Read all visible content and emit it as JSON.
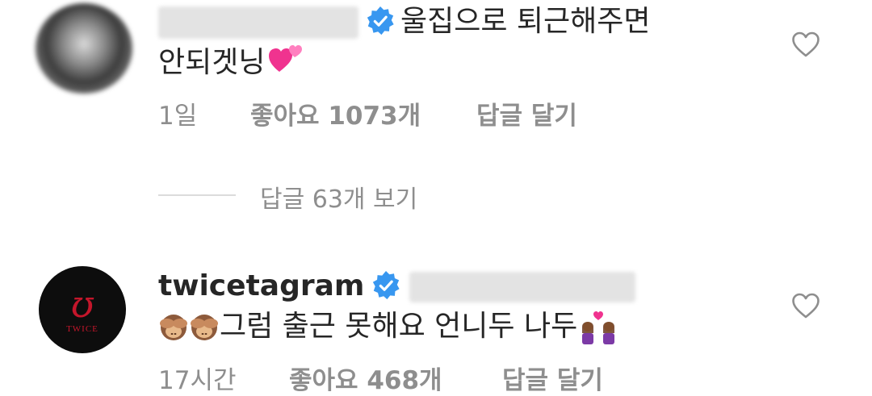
{
  "comments": [
    {
      "text_line1": "울집으로 퇴근해주면",
      "text_line2": "안되겟닝",
      "time": "1일",
      "likes": "좋아요 1073개",
      "reply": "답글 달기"
    },
    {
      "username": "twicetagram",
      "avatar_text": "TWICE",
      "text": "그럼 출근 못해요 언니두 나두",
      "time": "17시간",
      "likes": "좋아요 468개",
      "reply": "답글 달기"
    }
  ],
  "view_replies": "답글 63개 보기",
  "colors": {
    "text": "#262626",
    "secondary": "#8e8e8e",
    "verified": "#3897f0",
    "logo_red": "#c4162b"
  },
  "icons": {
    "verified": "verified-badge-icon",
    "like": "heart-outline-icon",
    "emoji_heart": "two-hearts-emoji",
    "emoji_monkey": "see-no-evil-monkey-emoji",
    "emoji_couple": "couple-with-heart-emoji"
  }
}
